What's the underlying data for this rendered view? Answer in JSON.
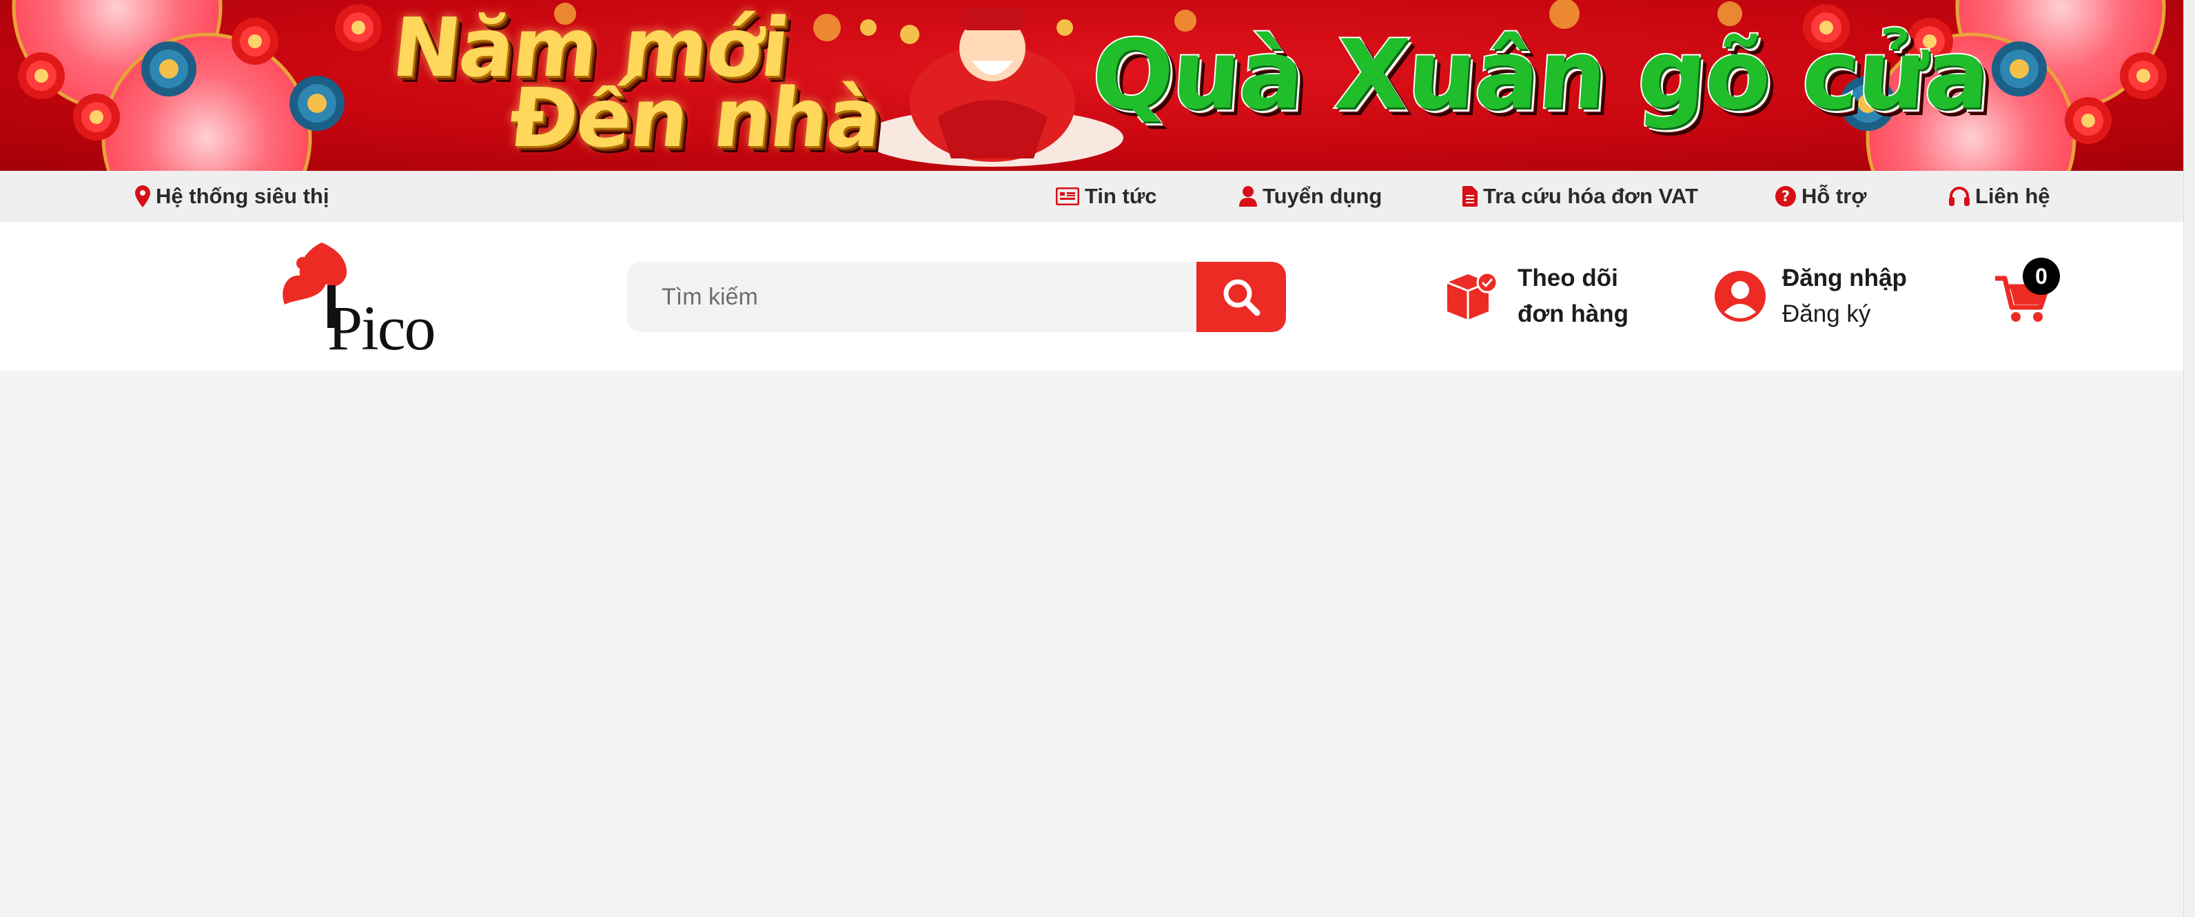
{
  "banner": {
    "line1": "Năm mới",
    "line2": "Đến nhà",
    "line3": "Quà Xuân gõ cửa"
  },
  "topbar": {
    "store_system": "Hệ thống siêu thị",
    "news": "Tin tức",
    "recruitment": "Tuyển dụng",
    "vat_invoice": "Tra cứu hóa đơn VAT",
    "support": "Hỗ trợ",
    "contact": "Liên hệ"
  },
  "header": {
    "logo_text": "Pico",
    "search_placeholder": "Tìm kiếm",
    "track_order_line1": "Theo dõi",
    "track_order_line2": "đơn hàng",
    "login": "Đăng nhập",
    "register": "Đăng ký",
    "cart_count": "0"
  },
  "colors": {
    "brand_red": "#ec2b24",
    "banner_red": "#c8060f",
    "topbar_bg": "#efefef",
    "page_bg": "#f3f3f3"
  },
  "icons": [
    "map-pin-icon",
    "newspaper-icon",
    "user-icon",
    "document-icon",
    "question-circle-icon",
    "headphones-icon",
    "search-icon",
    "box-check-icon",
    "user-circle-icon",
    "cart-icon"
  ]
}
